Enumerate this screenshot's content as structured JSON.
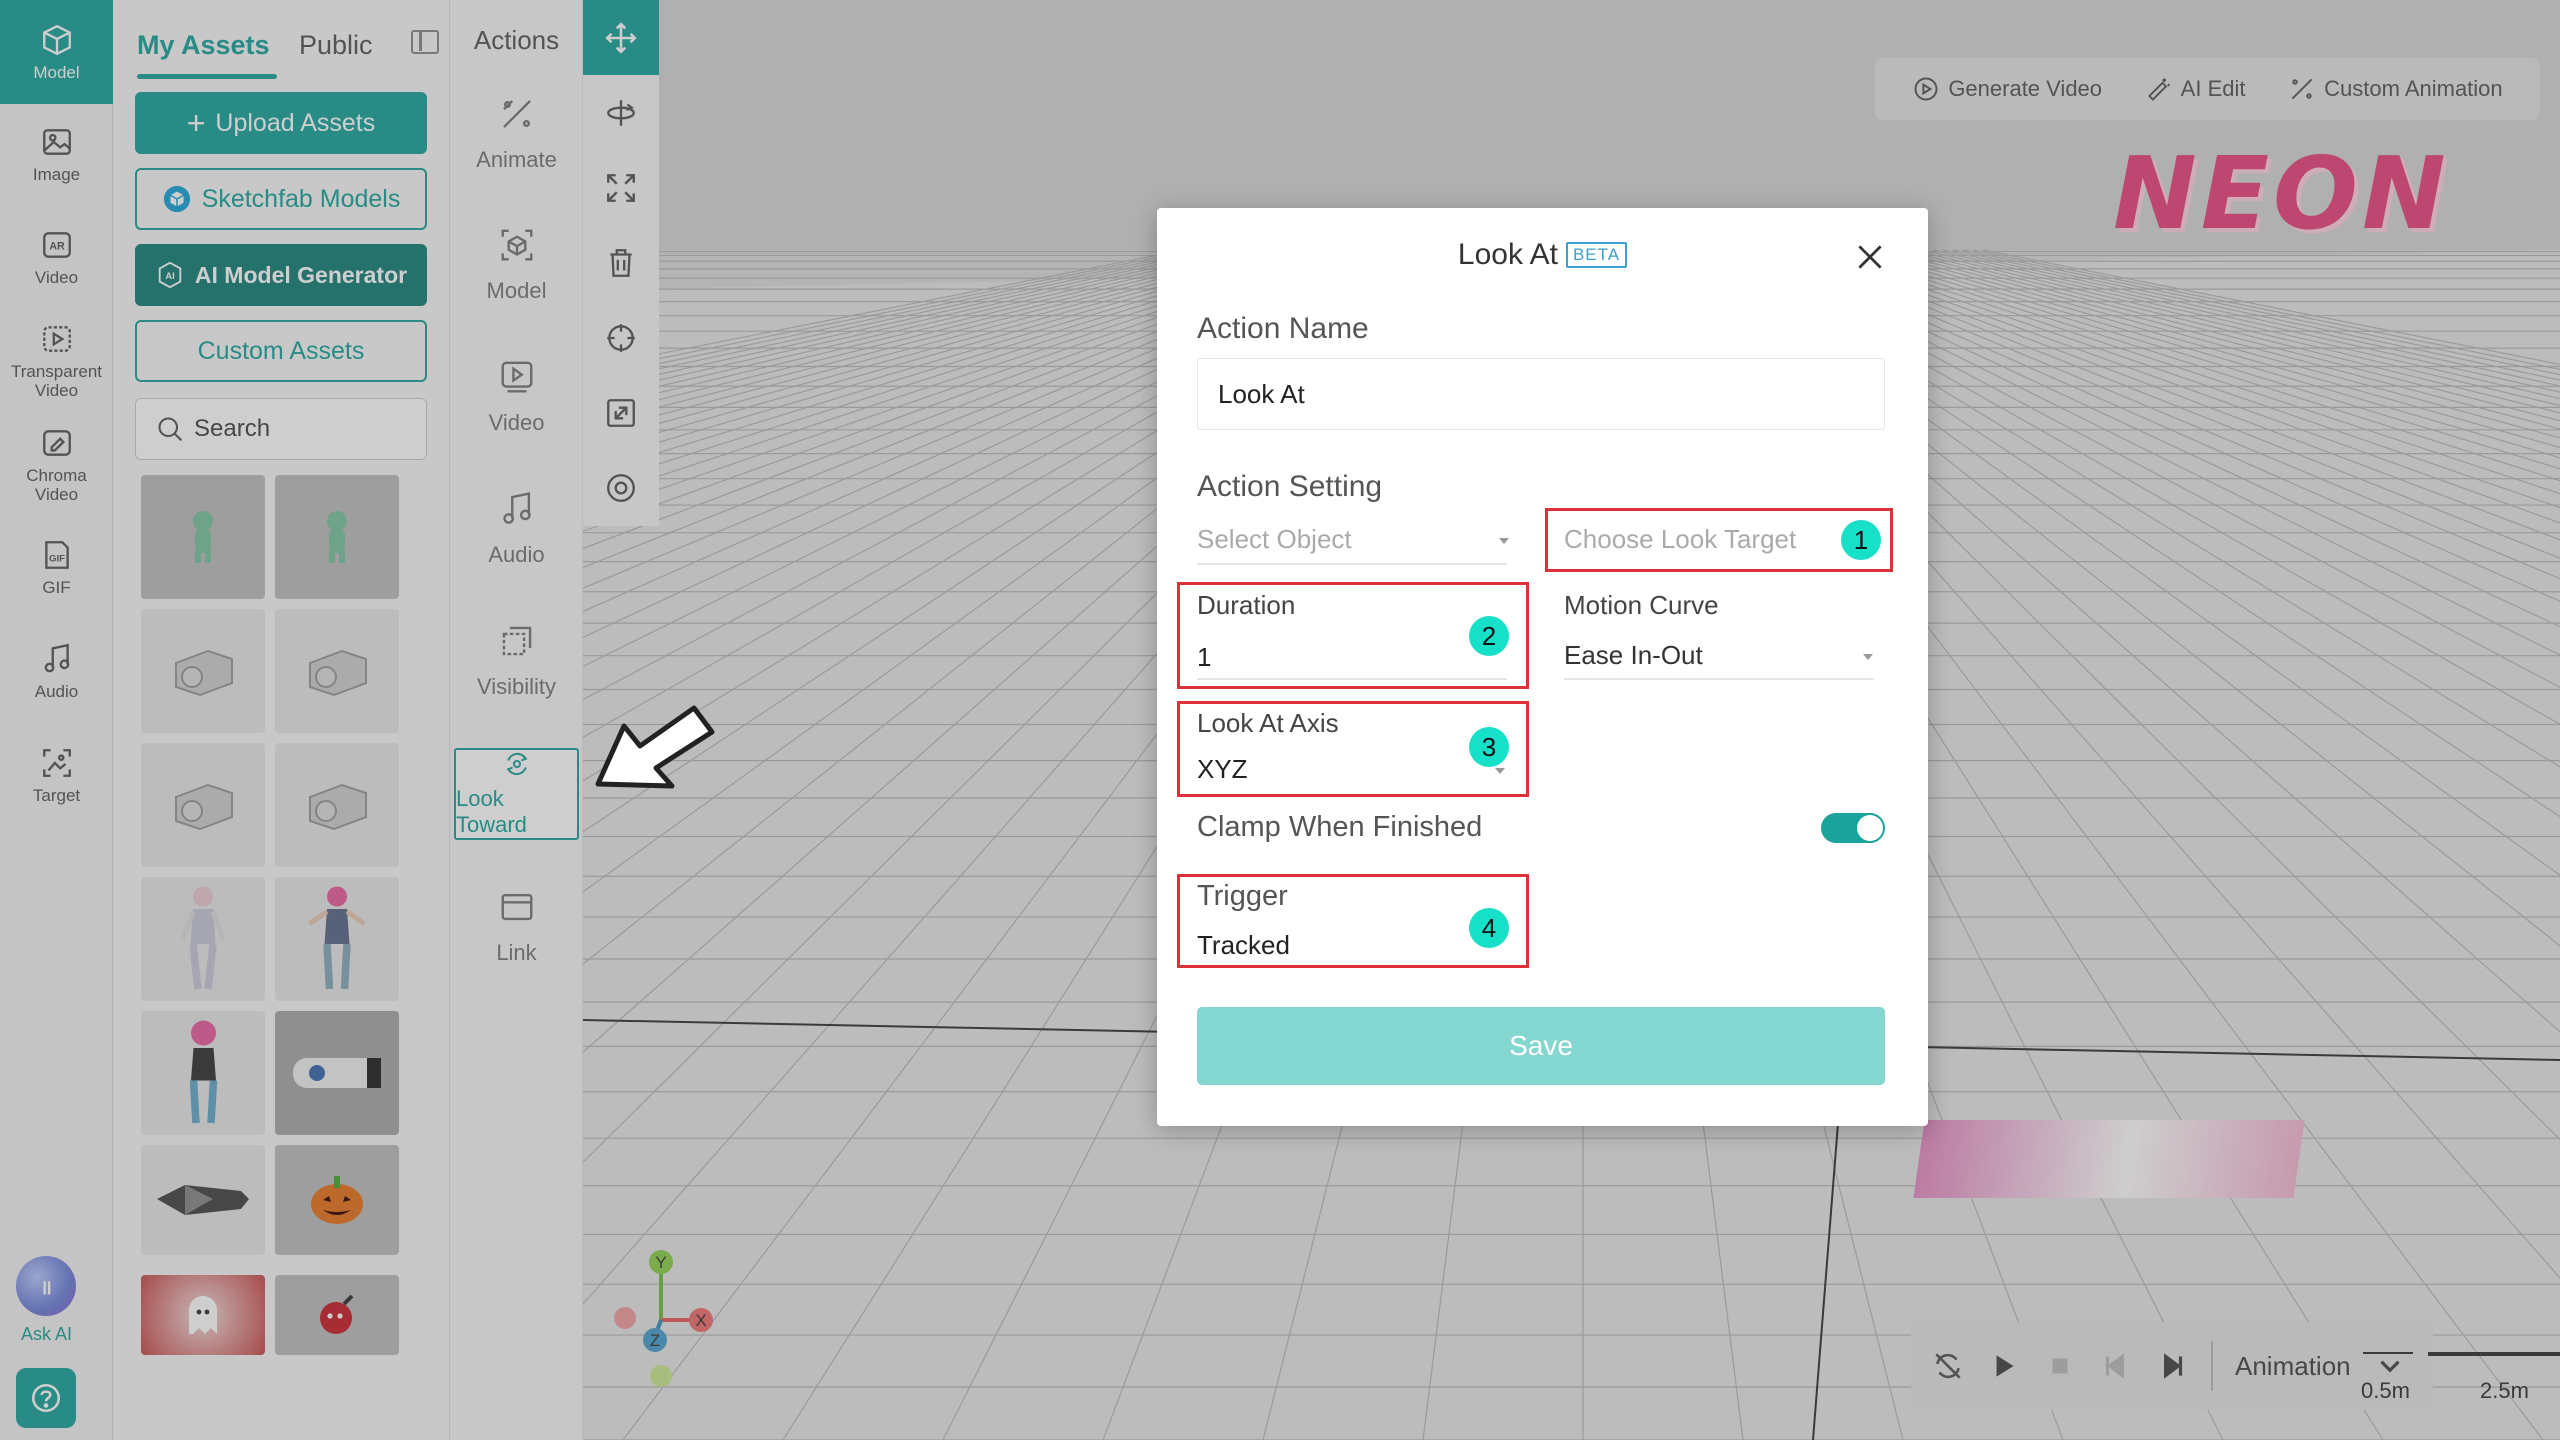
{
  "rail": {
    "items": [
      {
        "label": "Model",
        "icon": "cube-icon"
      },
      {
        "label": "Image",
        "icon": "image-icon"
      },
      {
        "label": "Video",
        "icon": "ar-video-icon"
      },
      {
        "label": "Transparent Video",
        "icon": "transparent-video-icon"
      },
      {
        "label": "Chroma Video",
        "icon": "chroma-video-icon"
      },
      {
        "label": "GIF",
        "icon": "gif-icon"
      },
      {
        "label": "Audio",
        "icon": "music-icon"
      },
      {
        "label": "Target",
        "icon": "target-image-icon"
      }
    ],
    "ask_ai_label": "Ask AI",
    "accent": "#1aa39a"
  },
  "assets": {
    "tabs": [
      "My Assets",
      "Public"
    ],
    "upload_label": "Upload Assets",
    "sketchfab_label": "Sketchfab Models",
    "ai_generator_label": "AI Model Generator",
    "ai_badge": "AI",
    "custom_label": "Custom Assets",
    "search_placeholder": "Search"
  },
  "actions": {
    "title": "Actions",
    "items": [
      "Animate",
      "Model",
      "Video",
      "Audio",
      "Visibility",
      "Look Toward",
      "Link"
    ]
  },
  "viewport": {
    "toolbar": [
      "Generate Video",
      "AI Edit",
      "Custom Animation"
    ],
    "scene_text": "NEON",
    "playback_label": "Animation",
    "scale_labels": [
      "0.5m",
      "2.5m"
    ],
    "axes": [
      "Y",
      "X",
      "Z"
    ]
  },
  "modal": {
    "title": "Look At",
    "beta": "BETA",
    "action_name_label": "Action Name",
    "action_name_value": "Look At",
    "action_setting_label": "Action Setting",
    "select_object_placeholder": "Select Object",
    "look_target_placeholder": "Choose Look Target",
    "duration_label": "Duration",
    "duration_value": "1",
    "motion_curve_label": "Motion Curve",
    "motion_curve_value": "Ease In-Out",
    "look_axis_label": "Look At Axis",
    "look_axis_value": "XYZ",
    "clamp_label": "Clamp When Finished",
    "clamp_enabled": true,
    "trigger_label": "Trigger",
    "trigger_value": "Tracked",
    "save_label": "Save",
    "badges": [
      "1",
      "2",
      "3",
      "4"
    ],
    "highlight_color": "#e0313a",
    "badge_color": "#17e0c8"
  }
}
